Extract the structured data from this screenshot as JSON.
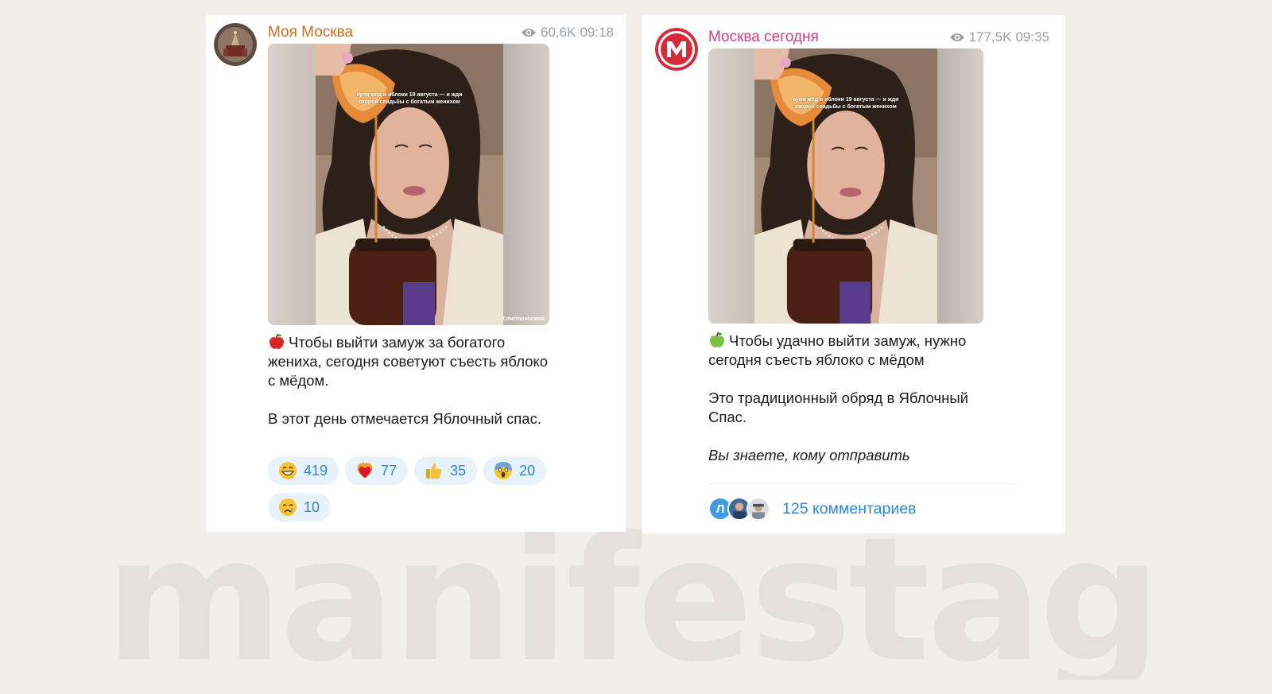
{
  "watermark": "manifestagenc",
  "posts": [
    {
      "channel": "Моя Москва",
      "views": "60,6K",
      "time": "09:18",
      "overlay_line1": "купи мёд и яблоки 19 августа — и жди",
      "overlay_line2": "скорой свадьбы с богатым женихом",
      "media_link": "t.me/moscowmi",
      "emoji": "🍎",
      "text_p1": "Чтобы выйти замуж за богатого жениха, сегодня советуют съесть яблоко с мёдом.",
      "text_p2": "В этот день отмечается Яблочный спас.",
      "reactions": [
        {
          "icon": "grin-icon",
          "count": "419"
        },
        {
          "icon": "heart-on-fire-icon",
          "count": "77"
        },
        {
          "icon": "thumbs-up-icon",
          "count": "35"
        },
        {
          "icon": "scream-icon",
          "count": "20"
        },
        {
          "icon": "crying-icon",
          "count": "10"
        }
      ],
      "colors": {
        "channel": "#d06b22"
      }
    },
    {
      "channel": "Москва сегодня",
      "views": "177,5K",
      "time": "09:35",
      "overlay_line1": "купи мёд и яблоки 19 августа — и жди",
      "overlay_line2": "скорой свадьбы с богатым женихом",
      "emoji": "🍏",
      "text_p1": "Чтобы удачно выйти замуж, нужно сегодня съесть яблоко с мёдом",
      "text_p2": "Это традиционный обряд в Яблочный Спас.",
      "text_p3": "Вы знаете, кому отправить",
      "commenter_initial": "Л",
      "comments": "125 комментариев",
      "colors": {
        "channel": "#d03c86",
        "accent": "#2f86d3"
      }
    }
  ]
}
